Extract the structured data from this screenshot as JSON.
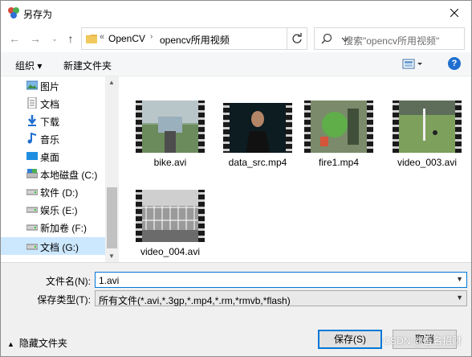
{
  "window": {
    "title": "另存为"
  },
  "address": {
    "prefix": "«",
    "crumbs": [
      "OpenCV",
      "opencv所用视频"
    ]
  },
  "search": {
    "placeholder": "搜索\"opencv所用视频\""
  },
  "toolbar": {
    "organize": "组织 ▾",
    "new_folder": "新建文件夹",
    "help": "?"
  },
  "sidebar": {
    "items": [
      {
        "label": "图片",
        "icon": "pictures-icon"
      },
      {
        "label": "文档",
        "icon": "documents-icon"
      },
      {
        "label": "下载",
        "icon": "download-icon"
      },
      {
        "label": "音乐",
        "icon": "music-icon"
      },
      {
        "label": "桌面",
        "icon": "desktop-icon"
      },
      {
        "label": "本地磁盘 (C:)",
        "icon": "drive-icon"
      },
      {
        "label": "软件 (D:)",
        "icon": "drive-icon"
      },
      {
        "label": "娱乐 (E:)",
        "icon": "drive-icon"
      },
      {
        "label": "新加卷 (F:)",
        "icon": "drive-icon"
      },
      {
        "label": "文档 (G:)",
        "icon": "drive-icon"
      }
    ]
  },
  "files": [
    {
      "name": "bike.avi"
    },
    {
      "name": "data_src.mp4"
    },
    {
      "name": "fire1.mp4"
    },
    {
      "name": "video_003.avi"
    },
    {
      "name": "video_004.avi"
    }
  ],
  "form": {
    "filename_label": "文件名(N):",
    "filename_value": "1.avi",
    "filetype_label": "保存类型(T):",
    "filetype_value": "所有文件(*.avi,*.3gp,*.mp4,*.rm,*rmvb,*flash)"
  },
  "footer": {
    "hide_folders": "隐藏文件夹",
    "save": "保存(S)",
    "cancel": "取消"
  },
  "watermark": "CSDN @吾名招财"
}
